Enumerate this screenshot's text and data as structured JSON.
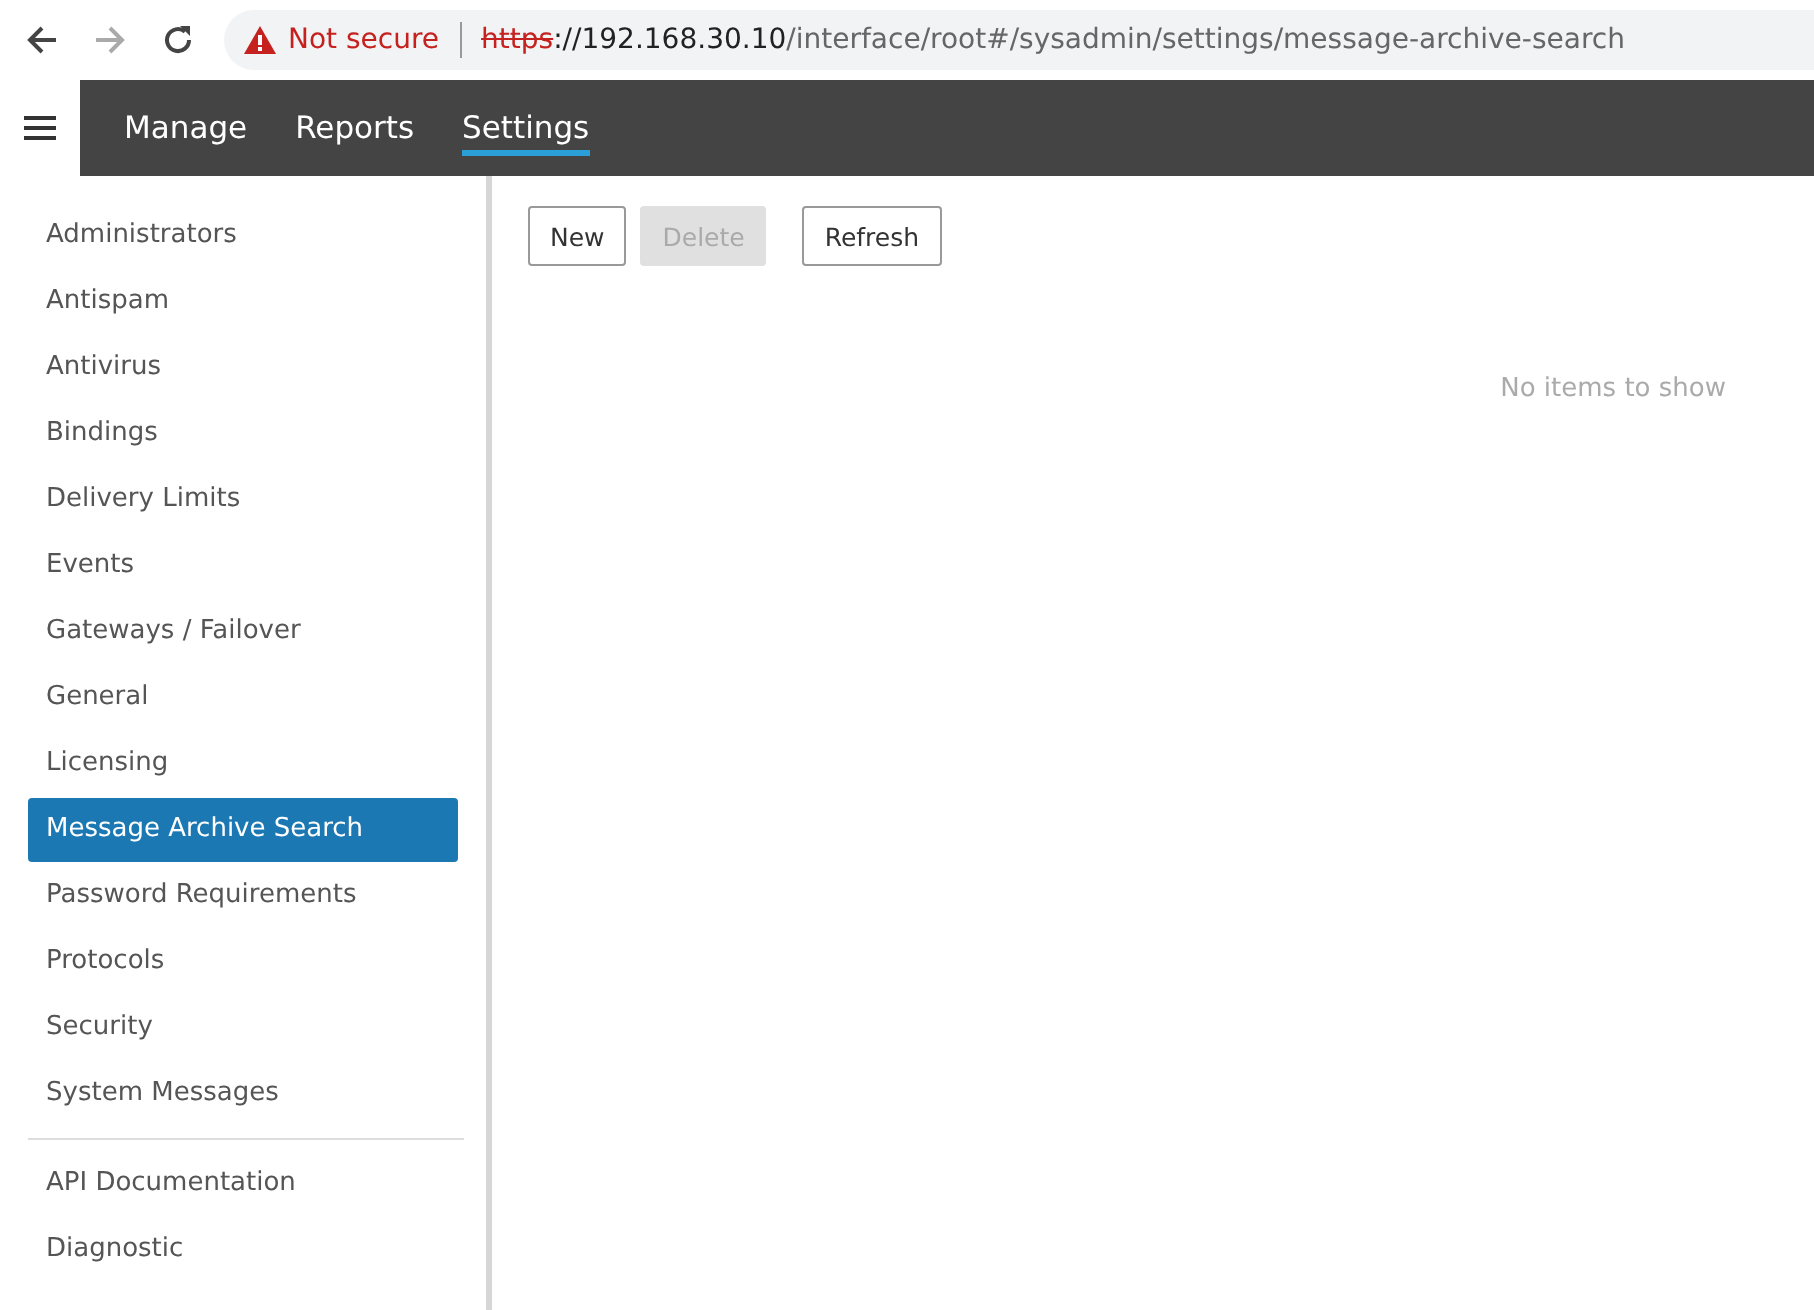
{
  "browser": {
    "security": "Not secure",
    "url_scheme": "https",
    "url_host": "://192.168.30.10",
    "url_path": "/interface/root#/sysadmin/settings/message-archive-search"
  },
  "nav": [
    {
      "label": "Manage",
      "selected": false
    },
    {
      "label": "Reports",
      "selected": false
    },
    {
      "label": "Settings",
      "selected": true
    }
  ],
  "sidebar": {
    "items": [
      {
        "label": "Administrators",
        "selected": false
      },
      {
        "label": "Antispam",
        "selected": false
      },
      {
        "label": "Antivirus",
        "selected": false
      },
      {
        "label": "Bindings",
        "selected": false
      },
      {
        "label": "Delivery Limits",
        "selected": false
      },
      {
        "label": "Events",
        "selected": false
      },
      {
        "label": "Gateways / Failover",
        "selected": false
      },
      {
        "label": "General",
        "selected": false
      },
      {
        "label": "Licensing",
        "selected": false
      },
      {
        "label": "Message Archive Search",
        "selected": true
      },
      {
        "label": "Password Requirements",
        "selected": false
      },
      {
        "label": "Protocols",
        "selected": false
      },
      {
        "label": "Security",
        "selected": false
      },
      {
        "label": "System Messages",
        "selected": false
      }
    ],
    "extra_items": [
      {
        "label": "API Documentation",
        "selected": false
      },
      {
        "label": "Diagnostic",
        "selected": false
      }
    ]
  },
  "toolbar": [
    {
      "label": "New",
      "disabled": false
    },
    {
      "label": "Delete",
      "disabled": true
    },
    {
      "label": "Refresh",
      "disabled": false
    }
  ],
  "empty_message": "No items to show"
}
